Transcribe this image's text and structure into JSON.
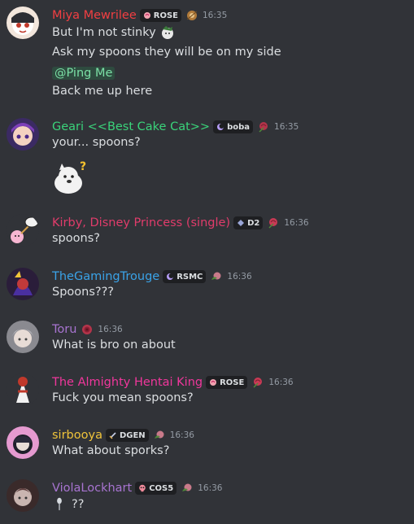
{
  "messages": [
    {
      "username": "Miya Mewrilee",
      "name_color": "#f23f42",
      "tag": {
        "label": "ROSE",
        "icon": "rose-icon"
      },
      "flair": "rose-badge-icon",
      "time": "16:35",
      "lines": [
        "But I'm not stinky",
        "Ask my spoons they will be on my side",
        "@Ping Me",
        "Back me up here"
      ]
    },
    {
      "username": "Geari <<Best Cake Cat>>",
      "name_color": "#3ad37a",
      "tag": {
        "label": "boba",
        "icon": "moon-icon"
      },
      "flair": "rose-badge-icon",
      "time": "16:35",
      "lines": [
        "your... spoons?"
      ],
      "sticker": "confused-cat-sticker"
    },
    {
      "username": "Kirby, Disney Princess (single)",
      "name_color": "#e13c6b",
      "tag": {
        "label": "D2",
        "icon": "diamond-icon"
      },
      "flair": "rose-badge-icon",
      "time": "16:36",
      "lines": [
        "spoons?"
      ]
    },
    {
      "username": "TheGamingTrouge",
      "name_color": "#3aa3e8",
      "tag": {
        "label": "RSMC",
        "icon": "moon-icon"
      },
      "flair": "rose-badge-icon",
      "time": "16:36",
      "lines": [
        "Spoons???"
      ]
    },
    {
      "username": "Toru",
      "name_color": "#a874d1",
      "flair": "rose-badge-icon",
      "time": "16:36",
      "lines": [
        "What is bro on about"
      ]
    },
    {
      "username": "The Almighty Hentai King",
      "name_color": "#f0379c",
      "tag": {
        "label": "ROSE",
        "icon": "rose-icon"
      },
      "flair": "rose-badge-icon",
      "time": "16:36",
      "lines": [
        "Fuck you mean spoons?"
      ]
    },
    {
      "username": "sirbooya",
      "name_color": "#f0c43a",
      "tag": {
        "label": "DGEN",
        "icon": "sword-icon"
      },
      "flair": "rose-badge-icon",
      "time": "16:36",
      "lines": [
        "What about sporks?"
      ]
    },
    {
      "username": "ViolaLockhart",
      "name_color": "#a874d1",
      "tag": {
        "label": "COS5",
        "icon": "skull-icon"
      },
      "flair": "rose-badge-icon",
      "time": "16:36",
      "lines": [
        "??"
      ],
      "line_emoji": "spoon-emoji"
    }
  ]
}
